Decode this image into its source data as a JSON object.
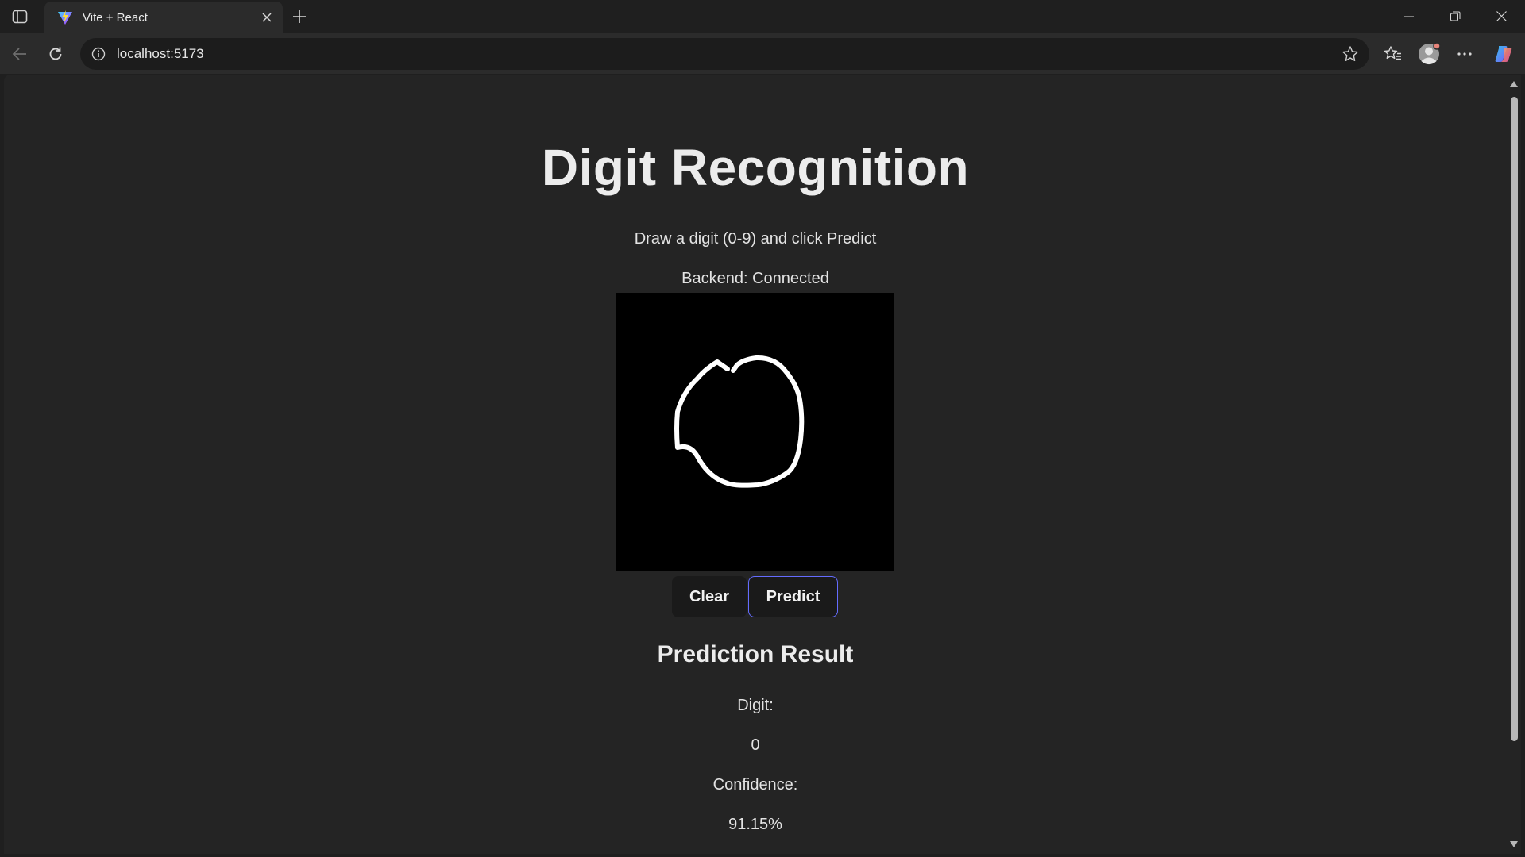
{
  "browser": {
    "tab_title": "Vite + React",
    "url": "localhost:5173"
  },
  "page": {
    "title": "Digit Recognition",
    "subtitle": "Draw a digit (0-9) and click Predict",
    "backend_status": "Backend: Connected",
    "buttons": {
      "clear": "Clear",
      "predict": "Predict"
    },
    "result": {
      "heading": "Prediction Result",
      "digit_label": "Digit:",
      "digit_value": "0",
      "confidence_label": "Confidence:",
      "confidence_value": "91.15%"
    }
  },
  "colors": {
    "page_bg": "#242424",
    "accent_border": "#646cff",
    "canvas_bg": "#000000",
    "stroke": "#ffffff"
  },
  "icons": [
    "sidebar-toggle-icon",
    "vite-logo-icon",
    "close-icon",
    "plus-icon",
    "minimize-icon",
    "restore-icon",
    "window-close-icon",
    "back-icon",
    "refresh-icon",
    "info-icon",
    "star-icon",
    "favorites-icon",
    "profile-icon",
    "more-icon",
    "copilot-icon"
  ]
}
